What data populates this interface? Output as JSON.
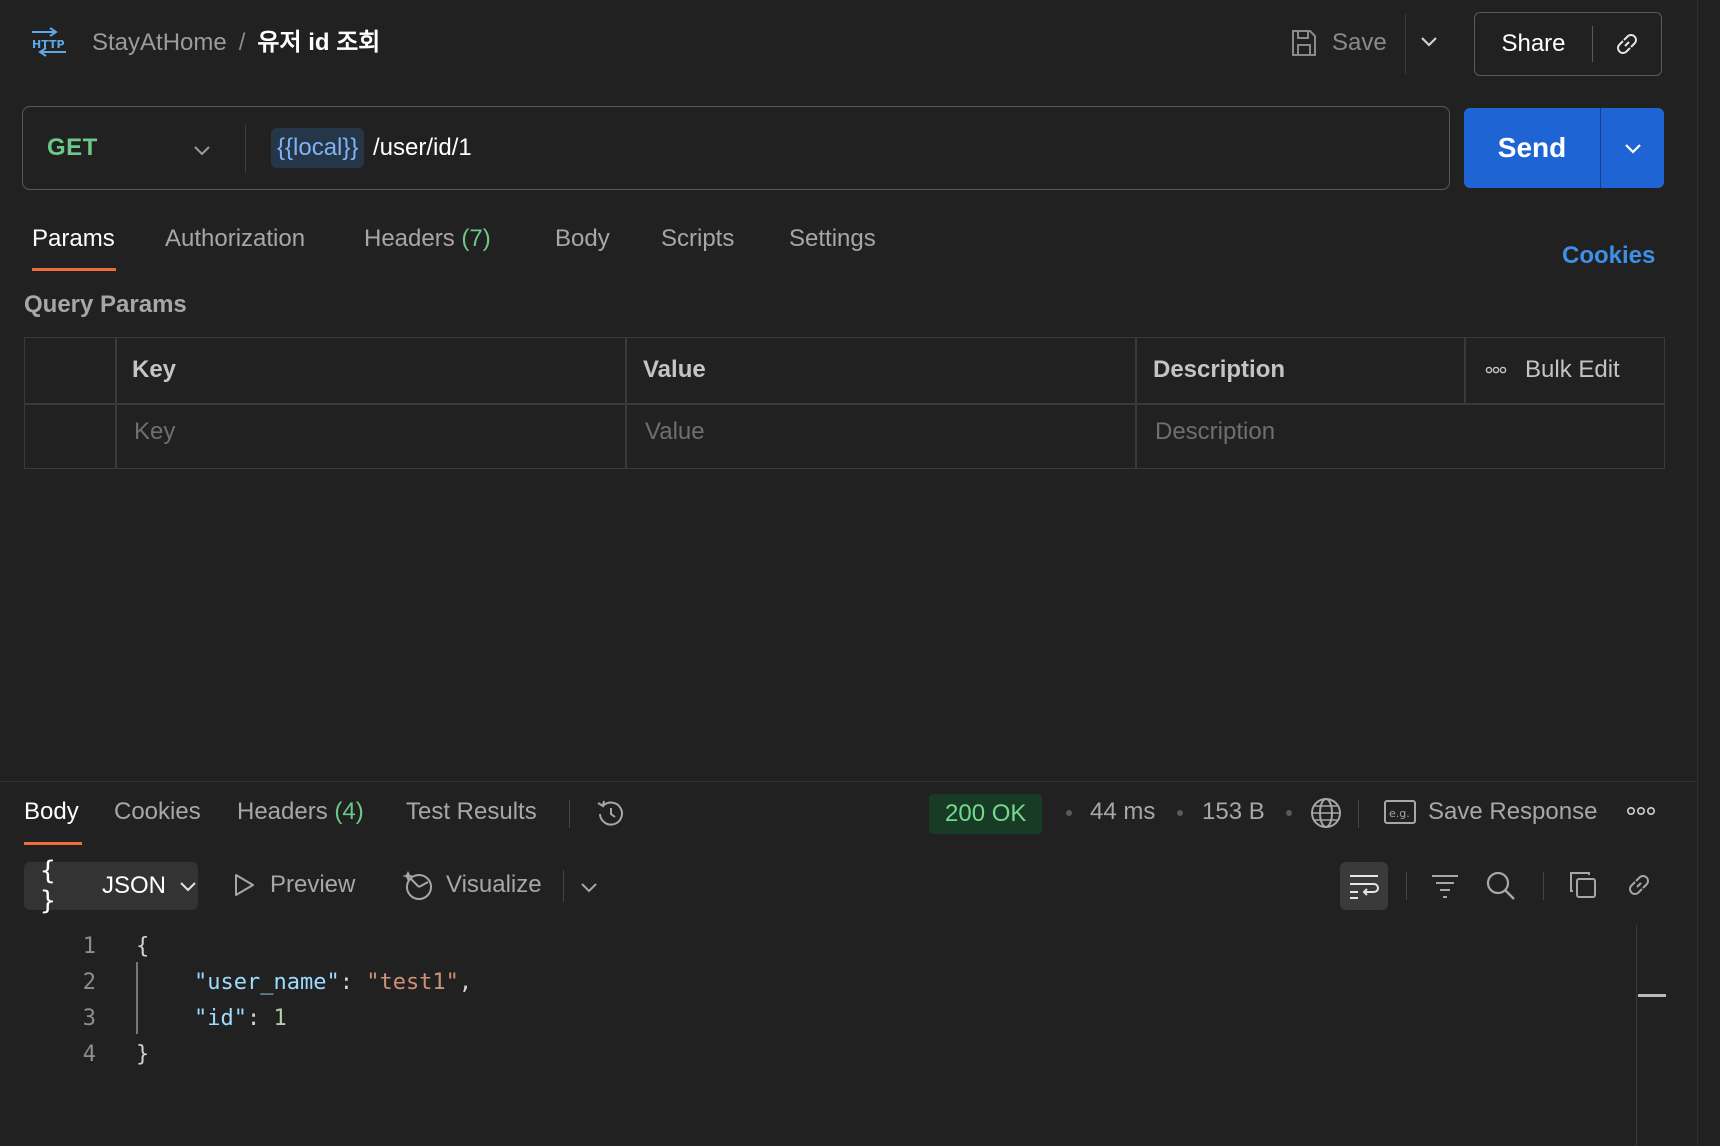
{
  "header": {
    "icon": "http-icon",
    "workspace": "StayAtHome",
    "separator": "/",
    "request_name": "유저 id 조회",
    "save_label": "Save",
    "share_label": "Share"
  },
  "request": {
    "method": "GET",
    "url_variable": "{{local}}",
    "url_path": "/user/id/1",
    "send_label": "Send"
  },
  "request_tabs": {
    "params": "Params",
    "authorization": "Authorization",
    "headers": "Headers",
    "headers_count": "(7)",
    "body": "Body",
    "scripts": "Scripts",
    "settings": "Settings",
    "active": "Params"
  },
  "cookies_link": "Cookies",
  "query_params": {
    "title": "Query Params",
    "columns": [
      "Key",
      "Value",
      "Description"
    ],
    "bulk_edit": "Bulk Edit",
    "placeholders": [
      "Key",
      "Value",
      "Description"
    ]
  },
  "response_tabs": {
    "body": "Body",
    "cookies": "Cookies",
    "headers": "Headers",
    "headers_count": "(4)",
    "test_results": "Test Results",
    "active": "Body"
  },
  "response_meta": {
    "status": "200 OK",
    "time": "44 ms",
    "size": "153 B",
    "save_response": "Save Response"
  },
  "response_toolbar": {
    "format": "JSON",
    "preview": "Preview",
    "visualize": "Visualize"
  },
  "code": {
    "line_numbers": [
      "1",
      "2",
      "3",
      "4"
    ],
    "open_brace": "{",
    "key1": "\"user_name\"",
    "colon": ": ",
    "val1": "\"test1\"",
    "comma": ",",
    "key2": "\"id\"",
    "val2": "1",
    "close_brace": "}"
  },
  "colors": {
    "background": "#212121",
    "accent_blue": "#1f64d4",
    "method_green": "#6cc788",
    "tab_underline": "#f26b3a",
    "status_bg": "#173b25"
  }
}
